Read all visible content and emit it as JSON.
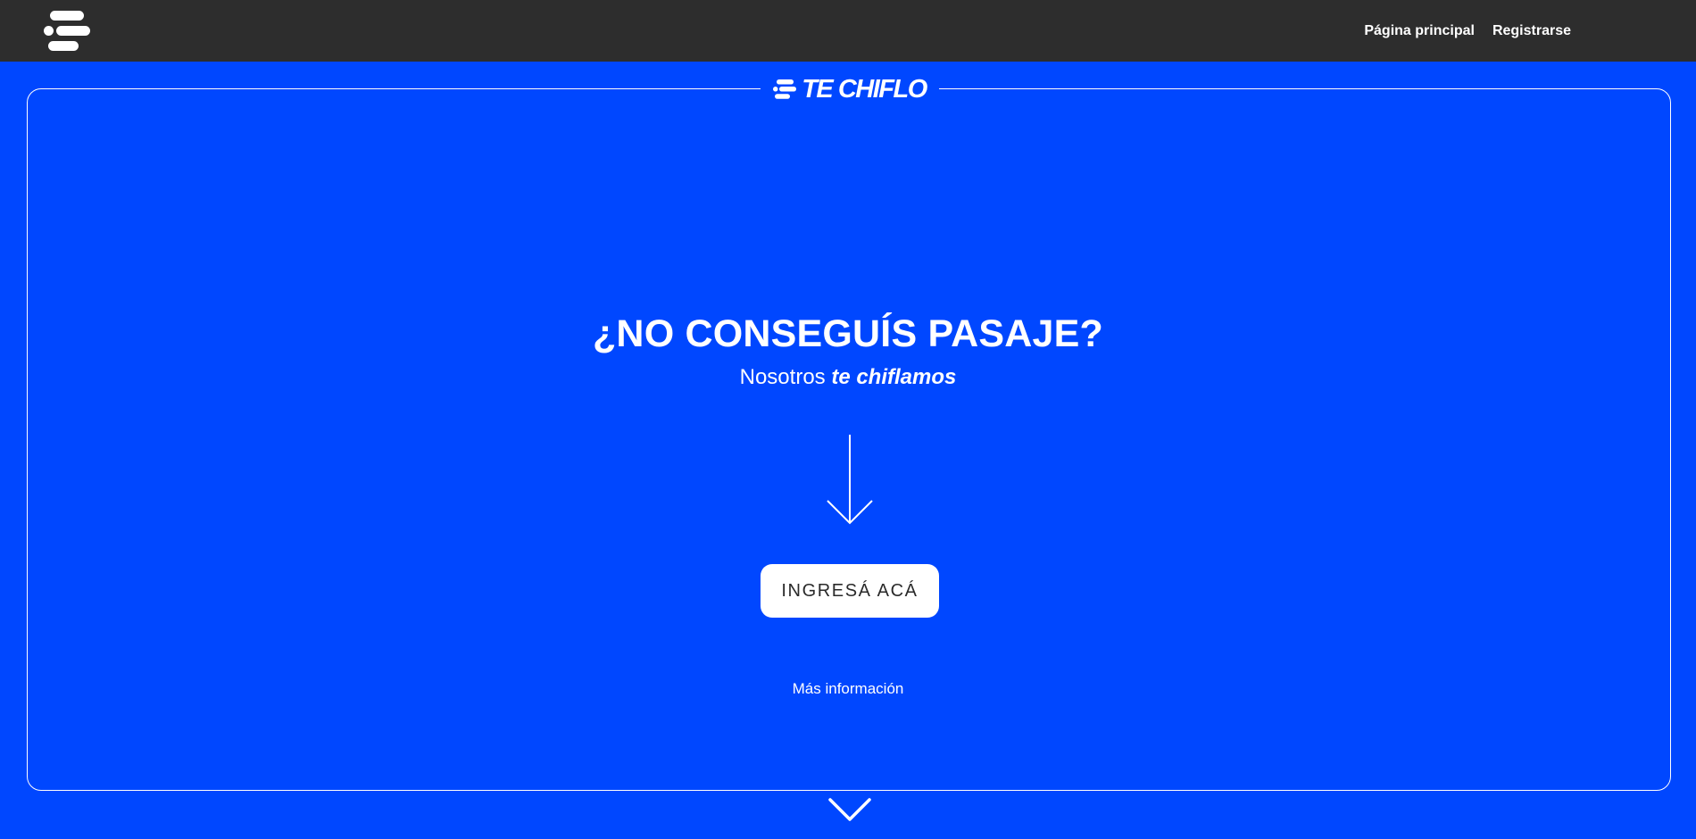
{
  "nav": {
    "logo_icon": "brand-lines-icon",
    "links": [
      {
        "label": "Página principal"
      },
      {
        "label": "Registrarse"
      }
    ]
  },
  "brand": {
    "name": "TE CHIFLO",
    "icon": "brand-lines-icon"
  },
  "hero": {
    "headline": "¿NO CONSEGUÍS PASAJE?",
    "subhead_plain": "Nosotros ",
    "subhead_emphasis": "te chiflamos",
    "arrow_icon": "arrow-down-icon",
    "cta_label": "INGRESÁ ACÁ",
    "more_info_label": "Más información",
    "scroll_icon": "chevron-down-icon"
  },
  "colors": {
    "background": "#0047FF",
    "topbar": "#2d2d2d",
    "text": "#ffffff",
    "cta_text": "#2a2a2a"
  }
}
